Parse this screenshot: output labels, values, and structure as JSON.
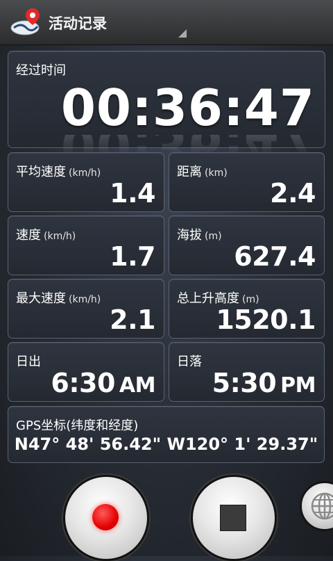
{
  "header": {
    "title": "活动记录",
    "app_icon": "map-pin-logo-icon",
    "menu_icon": "overflow-triangle-icon"
  },
  "timer": {
    "label": "经过时间",
    "value": "00:36:47"
  },
  "stats": {
    "avg_speed": {
      "label": "平均速度",
      "unit": "(km/h)",
      "value": "1.4"
    },
    "distance": {
      "label": "距离",
      "unit": "(km)",
      "value": "2.4"
    },
    "speed": {
      "label": "速度",
      "unit": "(km/h)",
      "value": "1.7"
    },
    "altitude": {
      "label": "海拔",
      "unit": "(m)",
      "value": "627.4"
    },
    "max_speed": {
      "label": "最大速度",
      "unit": "(km/h)",
      "value": "2.1"
    },
    "total_ascent": {
      "label": "总上升高度",
      "unit": "(m)",
      "value": "1520.1"
    },
    "sunrise": {
      "label": "日出",
      "time": "6:30",
      "ampm": "AM"
    },
    "sunset": {
      "label": "日落",
      "time": "5:30",
      "ampm": "PM"
    }
  },
  "gps": {
    "label": "GPS坐标(纬度和经度)",
    "value": "N47° 48' 56.42\"  W120° 1' 29.37\""
  },
  "controls": {
    "record": "record-icon",
    "stop": "stop-icon",
    "globe": "globe-icon"
  },
  "colors": {
    "record_red": "#e50000",
    "panel_border": "#5b6370"
  }
}
